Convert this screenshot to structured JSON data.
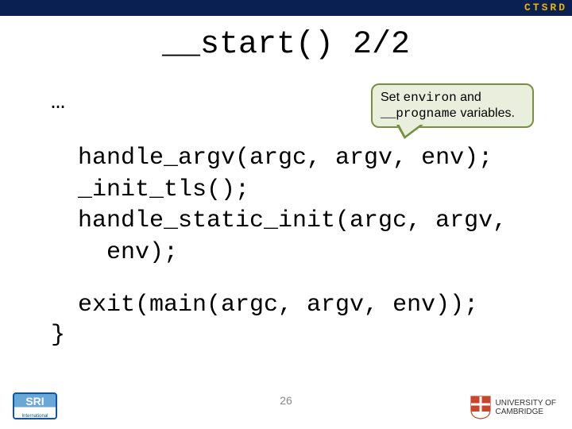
{
  "header": {
    "brand": "CTSRD"
  },
  "title": "__start() 2/2",
  "callout": {
    "pre": "Set ",
    "word1": "environ",
    "mid": " and ",
    "word2": "__progname",
    "post": " variables."
  },
  "ellipsis": "…",
  "code": {
    "block1": "handle_argv(argc, argv, env);\n_init_tls();\nhandle_static_init(argc, argv,\n  env);",
    "block2": "exit(main(argc, argv, env));",
    "closebrace": "}"
  },
  "pagenum": "26",
  "footer": {
    "sri_sub": "International",
    "cambridge_l1": "UNIVERSITY OF",
    "cambridge_l2": "CAMBRIDGE"
  }
}
